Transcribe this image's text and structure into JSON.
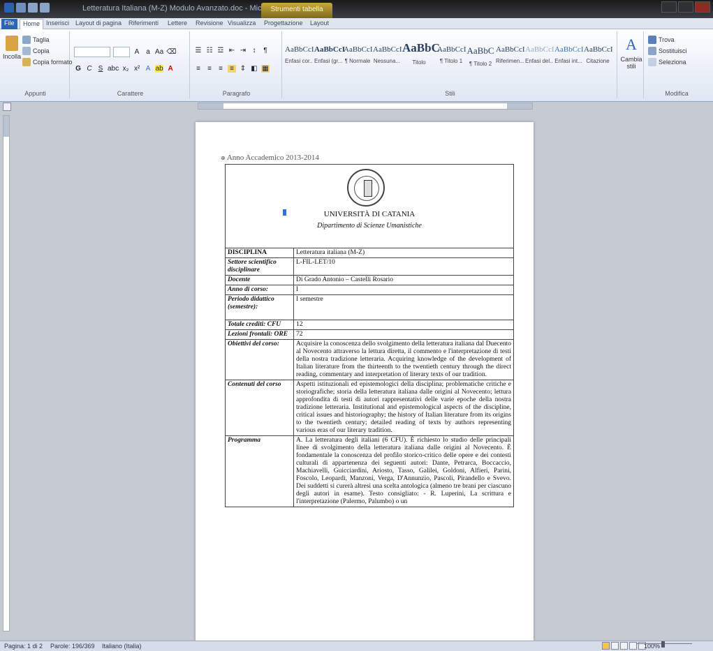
{
  "window": {
    "title": "Letteratura Italiana (M-Z) Modulo Avanzato.doc - Microsoft Word",
    "contextual_tab": "Strumenti tabella"
  },
  "ribbon": {
    "tabs": [
      "File",
      "Home",
      "Inserisci",
      "Layout di pagina",
      "Riferimenti",
      "Lettere",
      "Revisione",
      "Visualizza",
      "Progettazione",
      "Layout"
    ],
    "clipboard": {
      "paste": "Incolla",
      "cut": "Taglia",
      "copy": "Copia",
      "format_painter": "Copia formato",
      "label": "Appunti"
    },
    "font_label": "Carattere",
    "paragraph_label": "Paragrafo",
    "styles_label": "Stili",
    "styles": [
      {
        "preview": "AaBbCcI",
        "name": "Enfasi cor..."
      },
      {
        "preview": "AaBbCcI",
        "name": "Enfasi (gr..."
      },
      {
        "preview": "AaBbCcI",
        "name": "¶ Normale"
      },
      {
        "preview": "AaBbCcI",
        "name": "Nessuna..."
      },
      {
        "preview": "AaBbC",
        "name": "Titolo"
      },
      {
        "preview": "AaBbCcI",
        "name": "¶ Titolo 1"
      },
      {
        "preview": "AaBbC",
        "name": "¶ Titolo 2"
      },
      {
        "preview": "AaBbCcI",
        "name": "Riferimen..."
      },
      {
        "preview": "AaBbCcI",
        "name": "Enfasi del..."
      },
      {
        "preview": "AaBbCcI",
        "name": "Enfasi int..."
      },
      {
        "preview": "AaBbCcI",
        "name": "Citazione"
      }
    ],
    "change_styles": "Cambia stili",
    "editing": {
      "find": "Trova",
      "replace": "Sostituisci",
      "select": "Seleziona",
      "label": "Modifica"
    }
  },
  "document": {
    "header_line": "Anno Accademico 2013-2014",
    "university": "UNIVERSITÀ DI CATANIA",
    "department": "Dipartimento di Scienze Umanistiche",
    "rows": [
      {
        "label": "DISCIPLINA",
        "value": "Letteratura italiana (M-Z)",
        "plain": true
      },
      {
        "label": "Settore scientifico disciplinare",
        "value": "L-FIL-LET/10"
      },
      {
        "label": "Docente",
        "value": "Di Grado Antonio – Castelli Rosario"
      },
      {
        "label": "Anno di corso:",
        "value": "I"
      },
      {
        "label": "Periodo didattico (semestre):",
        "value": "I semestre"
      },
      {
        "label": "Totale crediti: CFU",
        "value": "12"
      },
      {
        "label": "Lezioni frontali: ORE",
        "value": "72"
      },
      {
        "label": "Obiettivi del corso:",
        "value": "Acquisire la conoscenza dello svolgimento della letteratura italiana dal Duecento al Novecento attraverso la lettura diretta, il commento e l'interpretazione di testi della nostra tradizione letteraria. Acquiring knowledge of the development of Italian literature from the thirteenth to the twentieth century through the direct reading, commentary and interpretation of literary texts of our tradition."
      },
      {
        "label": "Contenuti del corso",
        "value": "Aspetti istituzionali ed epistemologici della disciplina; problematiche critiche e storiografiche; storia della letteratura italiana dalle origini al Novecento; lettura approfondita di testi di autori rappresentativi delle varie epoche della nostra tradizione letteraria. Institutional and epistemological aspects of the discipline, critical issues and historiography; the history of Italian literature from its origins to the twentieth century; detailed reading of texts by authors representing various eras of our literary tradition."
      },
      {
        "label": "Programma",
        "value": "A. La letteratura degli italiani (6 CFU). È richiesto lo studio delle principali linee di svolgimento della letteratura italiana dalle origini al Novecento. È fondamentale la conoscenza del profilo storico-critico delle opere e dei contesti culturali di appartenenza dei seguenti autori: Dante, Petrarca, Boccaccio, Machiavelli, Guicciardini, Ariosto, Tasso, Galilei, Goldoni, Alfieri, Parini, Foscolo, Leopardi, Manzoni, Verga, D'Annunzio, Pascoli, Pirandello e Svevo. Dei suddetti si curerà altresì una scelta antologica (almeno tre brani per ciascuno degli autori in esame). Testo consigliato: - R. Luperini, La scrittura e l'interpretazione (Palermo, Palumbo) o un"
      }
    ]
  },
  "statusbar": {
    "page": "Pagina: 1 di 2",
    "words": "Parole: 196/369",
    "language": "Italiano (Italia)",
    "zoom": "100%"
  }
}
